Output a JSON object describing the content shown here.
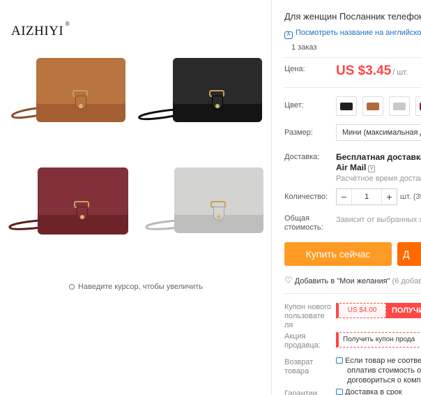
{
  "brand": {
    "name": "AIZHIYI",
    "mark": "®"
  },
  "gallery": {
    "zoom_hint": "Наведите курсор, чтобы увеличить",
    "bags": [
      {
        "name": "brown",
        "color": "#b06a3b"
      },
      {
        "name": "black",
        "color": "#1f1f1f"
      },
      {
        "name": "burgundy",
        "color": "#7a2a2e"
      },
      {
        "name": "gray",
        "color": "#c9c9c7"
      }
    ]
  },
  "product": {
    "title": "Для женщин Посланник телефон",
    "translate_link": "Посмотреть название на английском",
    "orders": "1 заказ",
    "price_label": "Цена:",
    "price": "US $3.45",
    "price_unit": "/ шт.",
    "color_label": "Цвет:",
    "color_swatches": [
      {
        "name": "black",
        "color": "#1f1f1f"
      },
      {
        "name": "brown",
        "color": "#b06a3b"
      },
      {
        "name": "gray",
        "color": "#c9c9c7"
      },
      {
        "name": "burgundy",
        "color": "#7a2a2e"
      }
    ],
    "size_label": "Размер:",
    "size_value": "Мини (максимальная д",
    "shipping_label": "Доставка:",
    "shipping_line1": "Бесплатная доставка в",
    "shipping_line2": "Air Mail",
    "shipping_line3": "Расчётное время достав",
    "qty_label": "Количество:",
    "qty_minus": "−",
    "qty_value": "1",
    "qty_plus": "+",
    "qty_note": "шт. (39",
    "total_label_1": "Общая",
    "total_label_2": "стоимость:",
    "total_value": "Зависит от выбранных ха",
    "buy_now": "Купить сейчас",
    "add_to_cart": "Д",
    "wishlist": "Добавить в \"Мои желания\"",
    "wishlist_count": "(6 добав",
    "coupon_label_1": "Купон нового",
    "coupon_label_2": "пользовате",
    "coupon_label_3": "ля",
    "coupon_amount": "US $4.00",
    "coupon_get": "ПОЛУЧИ",
    "seller_promo_label_1": "Акция",
    "seller_promo_label_2": "продавца:",
    "seller_coupon": "Получить купон прода",
    "return_label_1": "Возврат",
    "return_label_2": "товара",
    "return_line1": "Если товар не соответ",
    "return_line2": "оплатив стоимость об",
    "return_line3": "договориться о компе",
    "guarantee_label": "Гарантии",
    "guarantee_text": "Доставка в срок"
  },
  "colors": {
    "accent": "#ff4747",
    "buy": "#ff9a24",
    "cart": "#ff6a00",
    "link": "#1a6fc8"
  }
}
